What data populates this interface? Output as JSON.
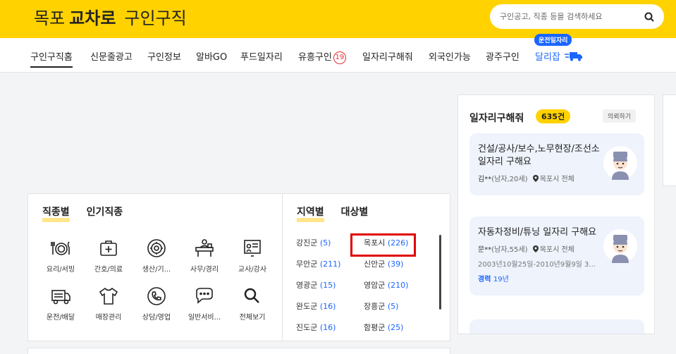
{
  "header": {
    "logo_part1": "목포",
    "logo_part2": "교차로",
    "logo_part3": "구인구직",
    "search_placeholder": "구인공고, 직종 등을 검색하세요",
    "brand_color": "#ffd200"
  },
  "nav": {
    "items": [
      "구인구직홈",
      "신문줄광고",
      "구인정보",
      "알바GO",
      "푸드일자리",
      "유흥구인",
      "일자리구해줘",
      "외국인가능",
      "광주구인",
      "달리잡"
    ],
    "badge": "19",
    "bubble": "운전일자리"
  },
  "left": {
    "tab_jobtype": "직종별",
    "tab_popular": "인기직종",
    "categories": [
      "요리/서빙",
      "간호/의료",
      "생산/기...",
      "사무/경리",
      "교사/강사",
      "운전/배달",
      "매장관리",
      "상담/영업",
      "일반서비...",
      "전체보기"
    ],
    "tab_region": "지역별",
    "tab_target": "대상별",
    "regions": [
      {
        "name": "강진군",
        "count": "(5)"
      },
      {
        "name": "목포시",
        "count": "(226)"
      },
      {
        "name": "무안군",
        "count": "(211)"
      },
      {
        "name": "신안군",
        "count": "(39)"
      },
      {
        "name": "영광군",
        "count": "(15)"
      },
      {
        "name": "영암군",
        "count": "(210)"
      },
      {
        "name": "완도군",
        "count": "(16)"
      },
      {
        "name": "장흥군",
        "count": "(5)"
      },
      {
        "name": "진도군",
        "count": "(16)"
      },
      {
        "name": "함평군",
        "count": "(25)"
      }
    ]
  },
  "right": {
    "title": "일자리구해줘",
    "count": "635건",
    "request": "의뢰하기",
    "cards": [
      {
        "title": "건설/공사/보수,노무현장/조선소 일자리 구해요",
        "name": "김**",
        "info": "(남자,20세)",
        "location": "목포시 전체"
      },
      {
        "title": "자동차정비/튜닝 일자리 구해요",
        "name": "문**",
        "info": "(남자,55세)",
        "location": "목포시 전체",
        "period": "2003년10월25일-2010년9월9일 3...",
        "exp_label": "경력",
        "exp_value": "19년"
      }
    ]
  }
}
